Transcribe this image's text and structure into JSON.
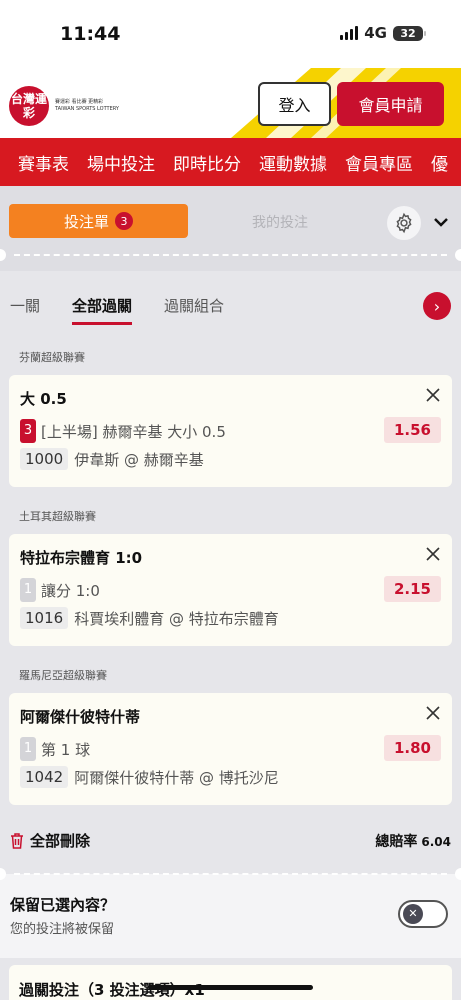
{
  "status": {
    "time": "11:44",
    "network": "4G",
    "battery": "32"
  },
  "header": {
    "logo_text": "台灣運彩",
    "logo_tagline_1": "賽運彩 看比賽 更精彩",
    "logo_tagline_2": "TAIWAN SPORTS LOTTERY",
    "login_label": "登入",
    "join_label": "會員申請"
  },
  "nav": [
    "賽事表",
    "場中投注",
    "即時比分",
    "運動數據",
    "會員專區",
    "優"
  ],
  "tabs": {
    "slip_label": "投注單",
    "slip_count": "3",
    "mine_label": "我的投注"
  },
  "bet_types": [
    "一關",
    "全部過關",
    "過關組合"
  ],
  "bets": [
    {
      "league": "芬蘭超級聯賽",
      "selection": "大 0.5",
      "leg": "3",
      "market": "[上半場] 赫爾辛基 大小 0.5",
      "odds": "1.56",
      "code": "1000",
      "match": "伊韋斯 @ 赫爾辛基"
    },
    {
      "league": "土耳其超級聯賽",
      "selection": "特拉布宗體育 1:0",
      "leg": "1",
      "market": "讓分 1:0",
      "odds": "2.15",
      "code": "1016",
      "match": "科賈埃利體育 @ 特拉布宗體育"
    },
    {
      "league": "羅馬尼亞超級聯賽",
      "selection": "阿爾傑什彼特什蒂",
      "leg": "1",
      "market": "第 1 球",
      "odds": "1.80",
      "code": "1042",
      "match": "阿爾傑什彼特什蒂 @ 博托沙尼"
    }
  ],
  "summary": {
    "delete_all": "全部刪除",
    "total_odds_label": "總賠率",
    "total_odds_value": "6.04"
  },
  "keep": {
    "title": "保留已選內容？",
    "subtitle": "您的投注將被保留"
  },
  "bottom": {
    "title": "過關投注（3 投注選項）x1"
  },
  "colors": {
    "brand_red": "#c8102e",
    "nav_red": "#d71920",
    "orange": "#f48120",
    "yellow": "#f5d200"
  }
}
